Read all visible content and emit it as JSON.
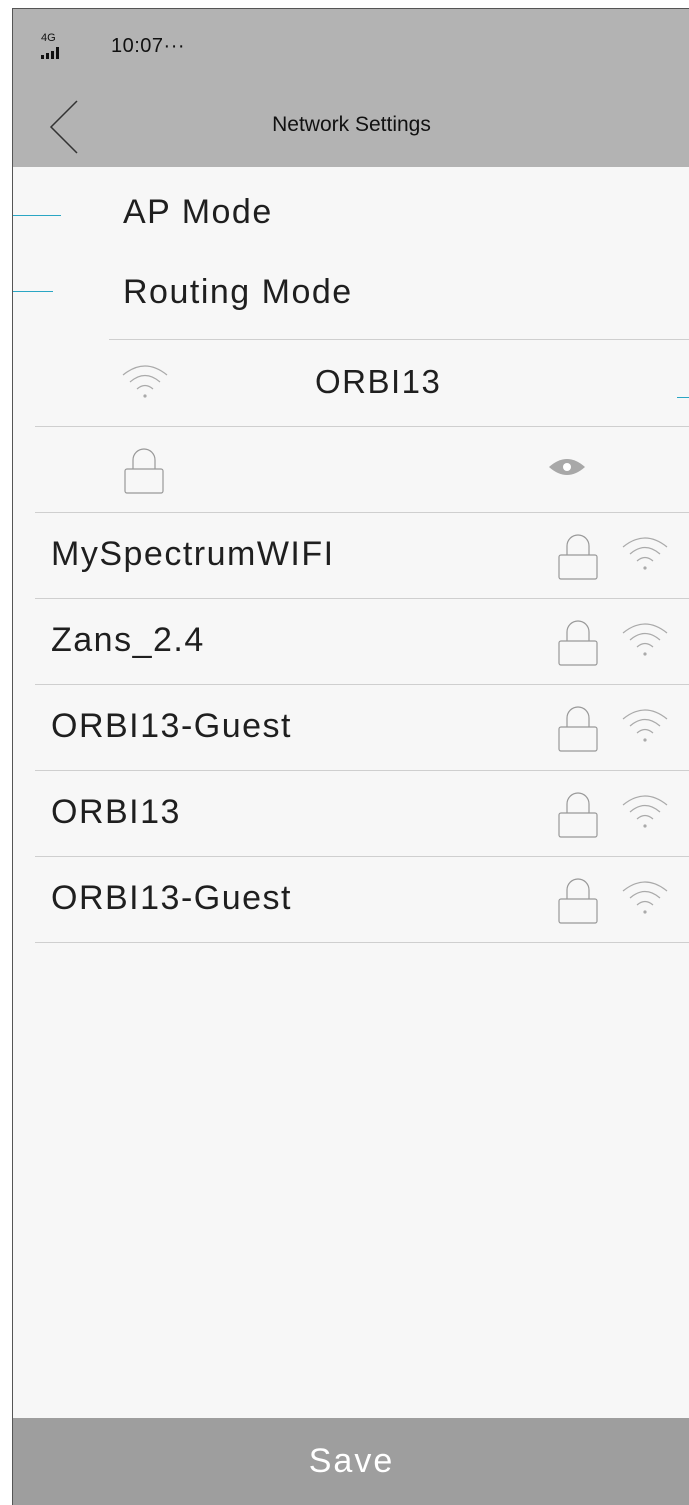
{
  "status_bar": {
    "network": "4G",
    "time": "10:07···"
  },
  "header": {
    "title": "Network Settings",
    "back_icon": "chevron-left-icon"
  },
  "modes": [
    {
      "label": "AP Mode"
    },
    {
      "label": "Routing Mode"
    }
  ],
  "ssid_field": {
    "value": "ORBI13",
    "icon": "wifi-icon"
  },
  "password_field": {
    "lock_icon": "lock-icon",
    "toggle_icon": "eye-icon"
  },
  "networks": [
    {
      "name": "MySpectrumWIFI",
      "secured": true,
      "icons": [
        "lock-icon",
        "wifi-icon"
      ]
    },
    {
      "name": "Zans_2.4",
      "secured": true,
      "icons": [
        "lock-icon",
        "wifi-icon"
      ]
    },
    {
      "name": "ORBI13-Guest",
      "secured": true,
      "icons": [
        "lock-icon",
        "wifi-icon"
      ]
    },
    {
      "name": "ORBI13",
      "secured": true,
      "icons": [
        "lock-icon",
        "wifi-icon"
      ]
    },
    {
      "name": "ORBI13-Guest",
      "secured": true,
      "icons": [
        "lock-icon",
        "wifi-icon"
      ]
    }
  ],
  "save_button": {
    "label": "Save"
  },
  "colors": {
    "header_bg": "#b3b3b3",
    "body_bg": "#f7f7f7",
    "save_bg": "#9e9e9e",
    "accent_line": "#2aa6c4"
  }
}
